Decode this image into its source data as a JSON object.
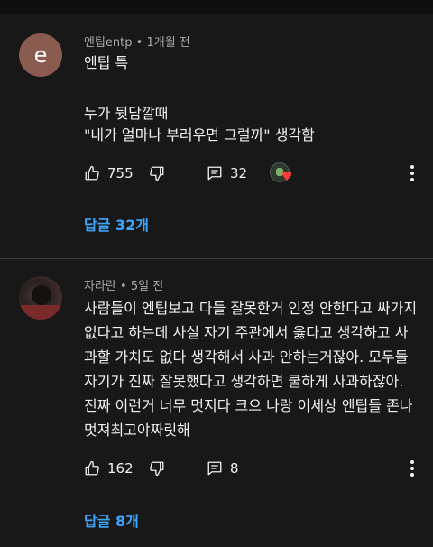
{
  "comments": [
    {
      "avatar_letter": "e",
      "avatar_color": "#8a5b4f",
      "author": "엔팁entp",
      "time": "1개월 전",
      "lines": [
        "엔팁 특",
        "",
        "누가 뒷담깔때",
        "\"내가 얼마나 부러우면 그럴까\" 생각함"
      ],
      "likes": "755",
      "replies_count": "32",
      "creator_heart": true,
      "view_replies": "답글 32개"
    },
    {
      "author": "자라란",
      "time": "5일 전",
      "text": "사람들이 엔팁보고 다들 잘못한거 인정 안한다고 싸가지없다고 하는데 사실 자기 주관에서 옳다고 생각하고 사과할 가치도 없다 생각해서 사과 안하는거잖아. 모두들 자기가 진짜 잘못했다고 생각하면 쿨하게 사과하잖아. 진짜 이런거 너무 멋지다 크으 나랑 이세상 엔팁들 존나멋져최고야짜릿해",
      "likes": "162",
      "replies_count": "8",
      "view_replies": "답글 8개"
    }
  ],
  "icons": {
    "like": "thumbs-up-icon",
    "dislike": "thumbs-down-icon",
    "reply": "reply-icon",
    "more": "more-vert-icon",
    "creator_heart": "creator-heart-icon"
  },
  "colors": {
    "background": "#181818",
    "link": "#3ea6ff",
    "meta": "#aaaaaa",
    "heart": "#ff3b3b"
  }
}
